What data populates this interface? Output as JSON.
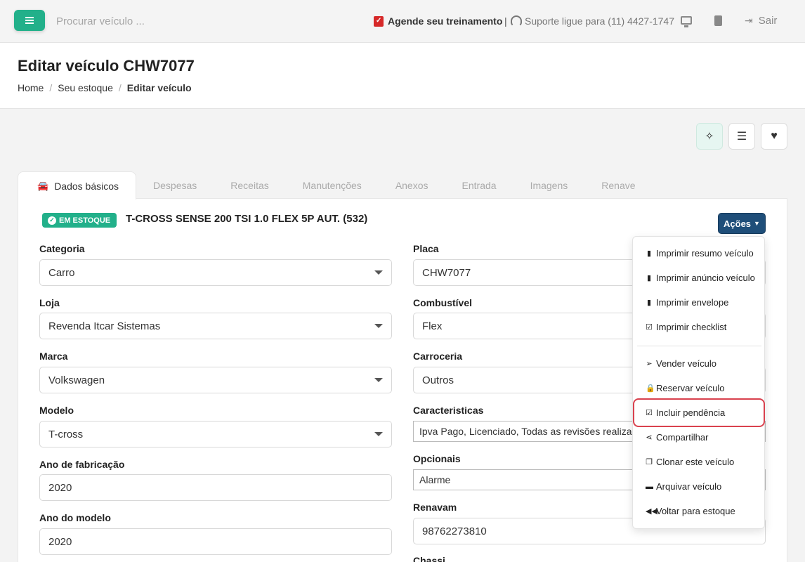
{
  "topbar": {
    "search_placeholder": "Procurar veículo ...",
    "training_label": "Agende seu treinamento",
    "separator": "|",
    "support_label": "Suporte ligue para (11) 4427-1747",
    "logout_label": "Sair"
  },
  "header": {
    "title": "Editar veículo CHW7077",
    "breadcrumb": [
      "Home",
      "Seu estoque",
      "Editar veículo"
    ]
  },
  "tabs": [
    "Dados básicos",
    "Despesas",
    "Receitas",
    "Manutenções",
    "Anexos",
    "Entrada",
    "Imagens",
    "Renave"
  ],
  "vehicle": {
    "status_badge": "EM ESTOQUE",
    "title": "T-CROSS SENSE 200 TSI 1.0 FLEX 5P AUT. (532)"
  },
  "actions_button": "Ações",
  "fields_left": [
    {
      "label": "Categoria",
      "value": "Carro"
    },
    {
      "label": "Loja",
      "value": "Revenda Itcar Sistemas"
    },
    {
      "label": "Marca",
      "value": "Volkswagen"
    },
    {
      "label": "Modelo",
      "value": "T-cross"
    },
    {
      "label": "Ano de fabricação",
      "value": "2020"
    },
    {
      "label": "Ano do modelo",
      "value": "2020"
    }
  ],
  "fields_right": [
    {
      "label": "Placa",
      "value": "CHW7077"
    },
    {
      "label": "Combustível",
      "value": "Flex"
    },
    {
      "label": "Carroceria",
      "value": "Outros"
    },
    {
      "label": "Caracteristicas",
      "value": "Ipva Pago, Licenciado, Todas as revisões realizadas"
    },
    {
      "label": "Opcionais",
      "value": "Alarme"
    },
    {
      "label": "Renavam",
      "value": "98762273810"
    },
    {
      "label": "Chassi",
      "value": ""
    }
  ],
  "menu": [
    {
      "label": "Imprimir resumo veículo",
      "icon": "file-icon"
    },
    {
      "label": "Imprimir anúncio veículo",
      "icon": "file-icon"
    },
    {
      "label": "Imprimir envelope",
      "icon": "file-icon"
    },
    {
      "label": "Imprimir checklist",
      "icon": "checkbox-icon"
    },
    {
      "label": "Vender veículo",
      "icon": "paper-plane-icon"
    },
    {
      "label": "Reservar veículo",
      "icon": "lock-icon"
    },
    {
      "label": "Incluir pendência",
      "icon": "clipboard-check-icon"
    },
    {
      "label": "Compartilhar",
      "icon": "share-icon"
    },
    {
      "label": "Clonar este veículo",
      "icon": "copy-icon"
    },
    {
      "label": "Arquivar veículo",
      "icon": "archive-icon"
    },
    {
      "label": "Voltar para estoque",
      "icon": "backward-icon"
    }
  ],
  "colors": {
    "brand_green": "#22b08a",
    "actions_blue": "#1f4e79",
    "highlight_red": "#d9414e",
    "calendar_red": "#d62828"
  }
}
